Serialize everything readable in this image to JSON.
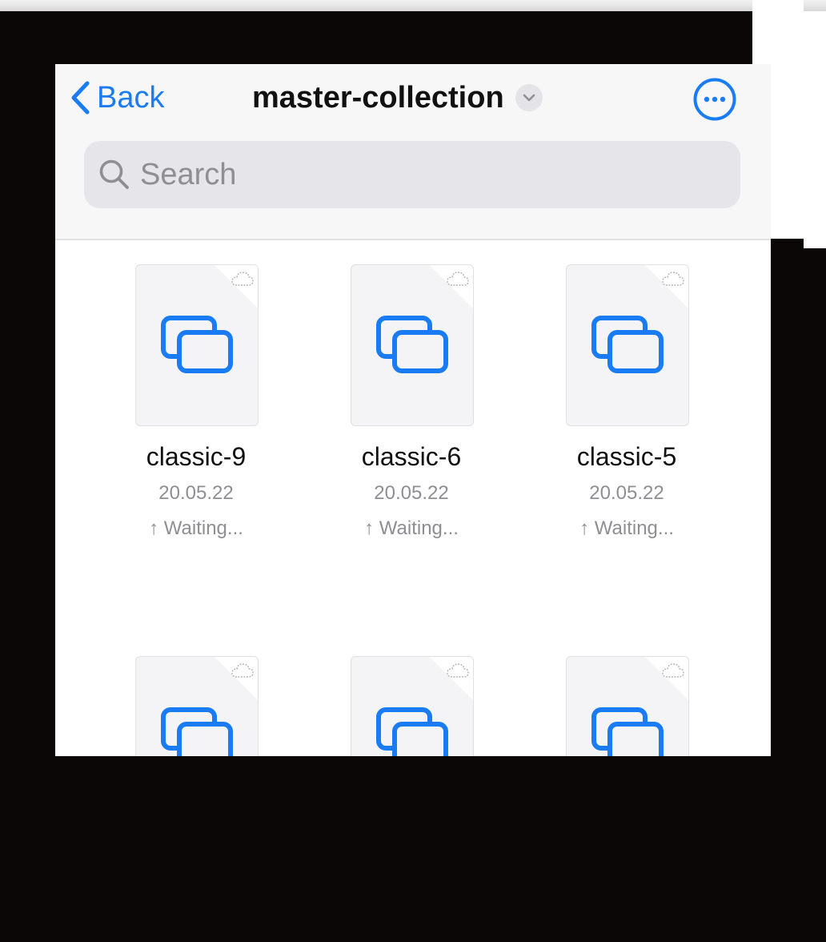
{
  "nav": {
    "back_label": "Back",
    "title": "master-collection"
  },
  "search": {
    "placeholder": "Search"
  },
  "files": [
    {
      "name": "classic-9",
      "date": "20.05.22",
      "status": "↑ Waiting..."
    },
    {
      "name": "classic-6",
      "date": "20.05.22",
      "status": "↑ Waiting..."
    },
    {
      "name": "classic-5",
      "date": "20.05.22",
      "status": "↑ Waiting..."
    },
    {
      "name": "",
      "date": "",
      "status": ""
    },
    {
      "name": "",
      "date": "",
      "status": ""
    },
    {
      "name": "",
      "date": "",
      "status": ""
    }
  ],
  "icons": {
    "back": "chevron-left-icon",
    "title_menu": "chevron-down-icon",
    "more": "ellipsis-circle-icon",
    "search": "search-icon",
    "cloud": "cloud-icon",
    "file": "stacked-windows-icon"
  },
  "colors": {
    "accent": "#1a7cf5",
    "secondary_text": "#8e8e93",
    "search_bg": "#e5e5ea",
    "navbar_bg": "#f7f7f8"
  }
}
